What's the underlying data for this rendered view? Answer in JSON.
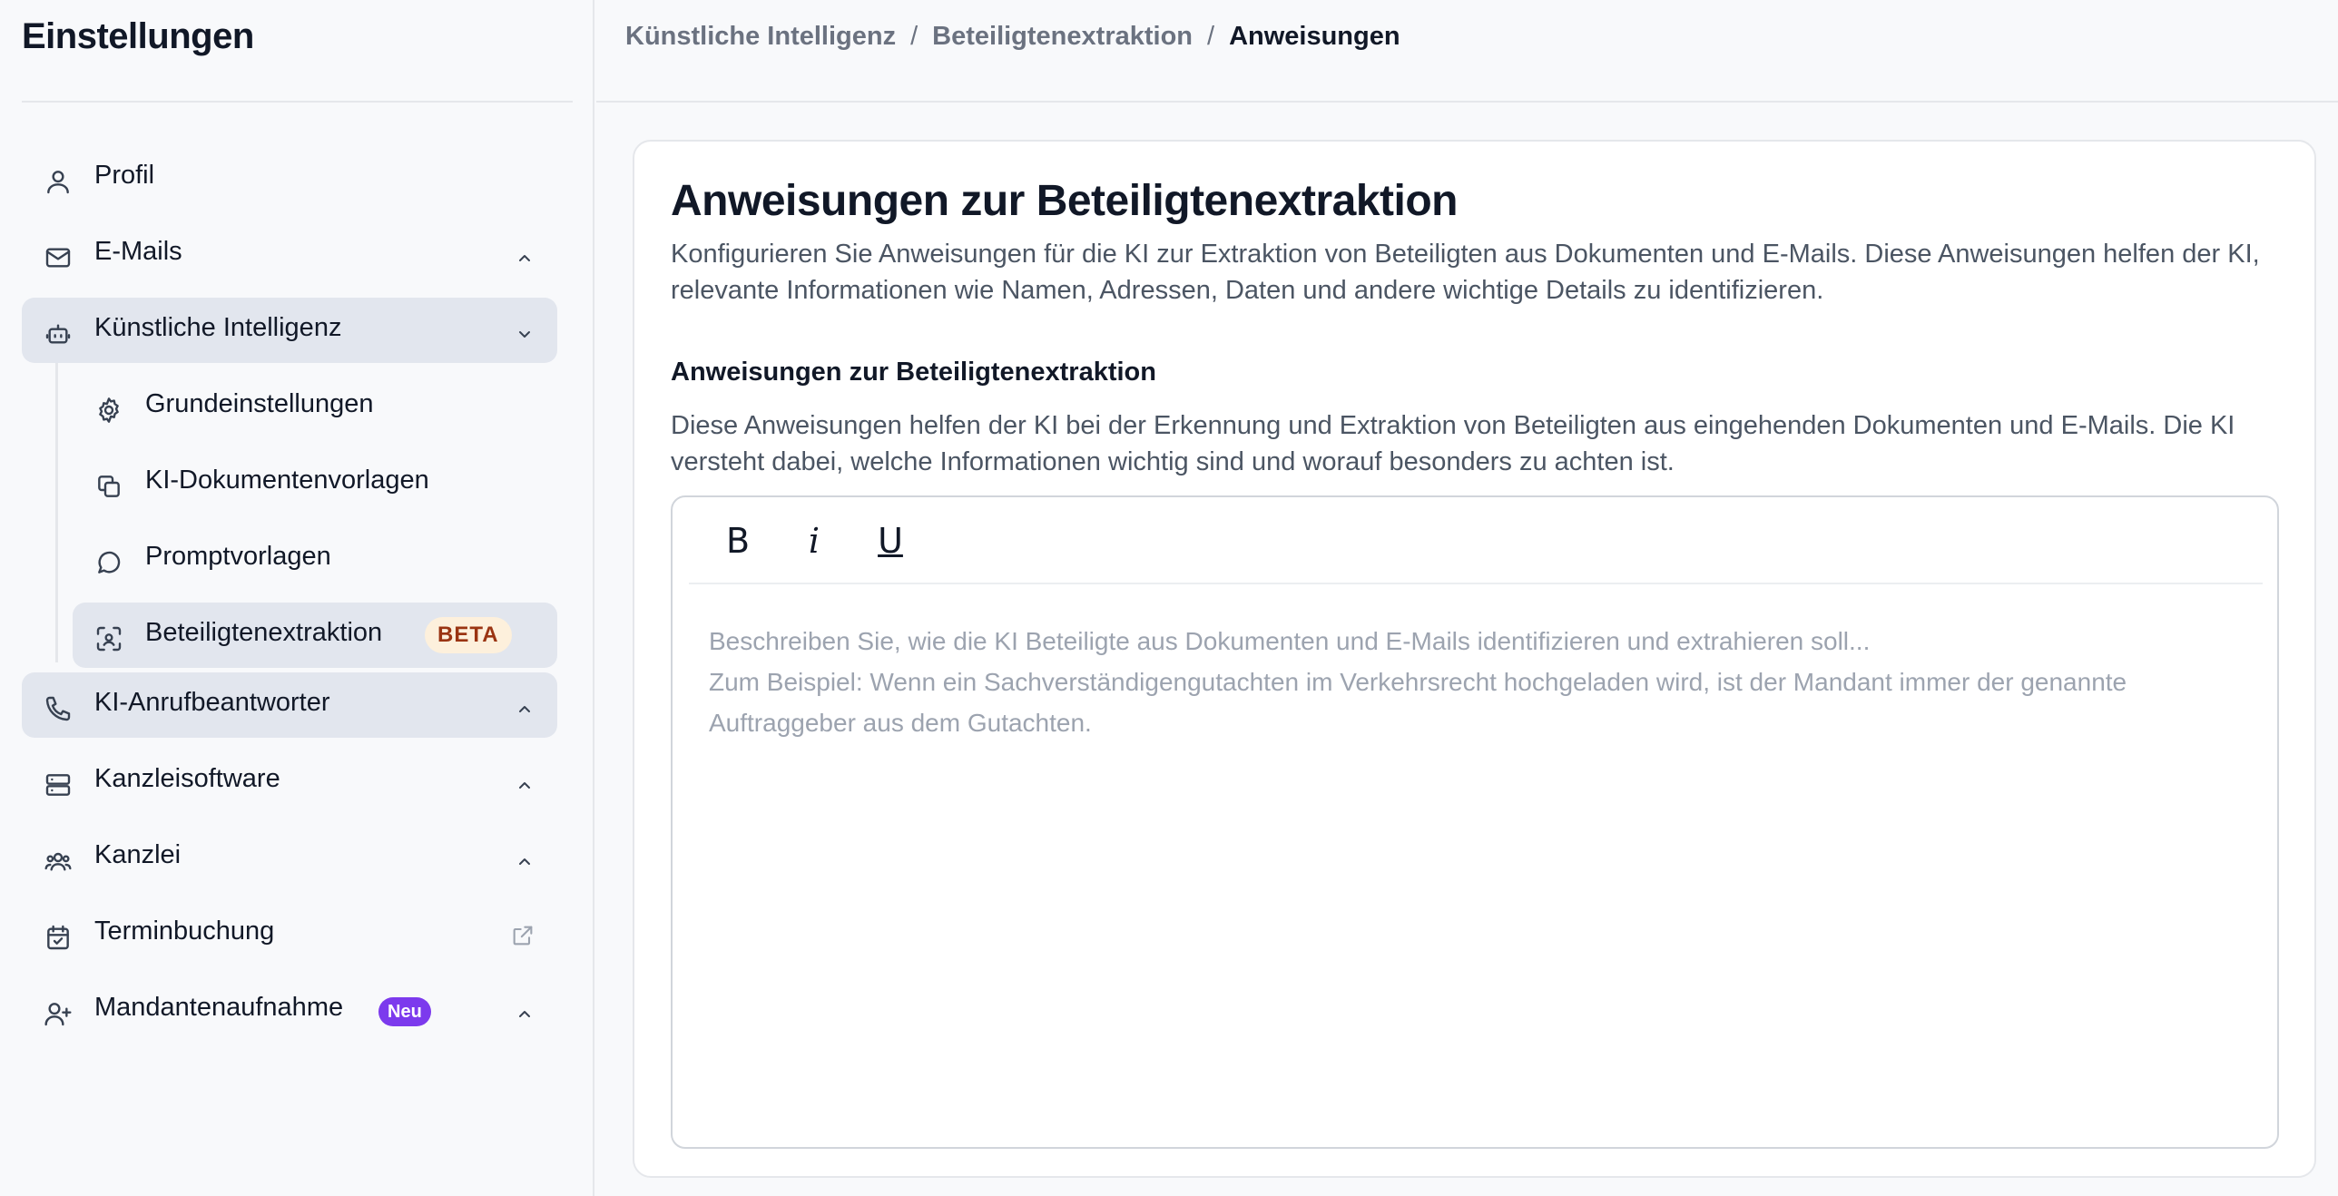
{
  "sidebar": {
    "title": "Einstellungen",
    "items": [
      {
        "label": "Profil",
        "icon": "user-icon",
        "chevron": "none"
      },
      {
        "label": "E-Mails",
        "icon": "mail-icon",
        "chevron": "up"
      },
      {
        "label": "Künstliche Intelligenz",
        "icon": "robot-icon",
        "chevron": "down",
        "active": true
      },
      {
        "label": "KI-Anrufbeantworter",
        "icon": "phone-icon",
        "chevron": "up",
        "active": true
      },
      {
        "label": "Kanzleisoftware",
        "icon": "server-icon",
        "chevron": "up"
      },
      {
        "label": "Kanzlei",
        "icon": "users-icon",
        "chevron": "up"
      },
      {
        "label": "Terminbuchung",
        "icon": "calendar-check-icon",
        "chevron": "external-link"
      },
      {
        "label": "Mandantenaufnahme",
        "icon": "user-plus-icon",
        "chevron": "up",
        "badge": "Neu"
      }
    ],
    "sub_items": [
      {
        "label": "Grundeinstellungen",
        "icon": "gear-icon"
      },
      {
        "label": "KI-Dokumentenvorlagen",
        "icon": "copy-icon"
      },
      {
        "label": "Promptvorlagen",
        "icon": "chat-bubble-icon"
      },
      {
        "label": "Beteiligtenextraktion",
        "icon": "scan-face-icon",
        "badge": "BETA",
        "active": true
      }
    ]
  },
  "breadcrumb": {
    "items": [
      "Künstliche Intelligenz",
      "Beteiligtenextraktion",
      "Anweisungen"
    ],
    "separator": "/"
  },
  "main": {
    "title": "Anweisungen zur Beteiligtenextraktion",
    "description": "Konfigurieren Sie Anweisungen für die KI zur Extraktion von Beteiligten aus Dokumenten und E-Mails. Diese Anweisungen helfen der KI, relevante Informationen wie Namen, Adressen, Daten und andere wichtige Details zu identifizieren.",
    "section_title": "Anweisungen zur Beteiligtenextraktion",
    "section_description": "Diese Anweisungen helfen der KI bei der Erkennung und Extraktion von Beteiligten aus eingehenden Dokumenten und E-Mails. Die KI versteht dabei, welche Informationen wichtig sind und worauf besonders zu achten ist.",
    "editor": {
      "bold_label": "B",
      "italic_label": "i",
      "underline_label": "U",
      "value": "",
      "placeholder": "Beschreiben Sie, wie die KI Beteiligte aus Dokumenten und E-Mails identifizieren und extrahieren soll...\nZum Beispiel: Wenn ein Sachverständigengutachten im Verkehrsrecht hochgeladen wird, ist der Mandant immer der genannte Auftraggeber aus dem Gutachten."
    }
  },
  "colors": {
    "active_bg": "#e2e6ee",
    "beta_badge_bg": "#fdf0dc",
    "beta_badge_text": "#9a3412",
    "neu_badge_bg": "#7c3aed"
  }
}
